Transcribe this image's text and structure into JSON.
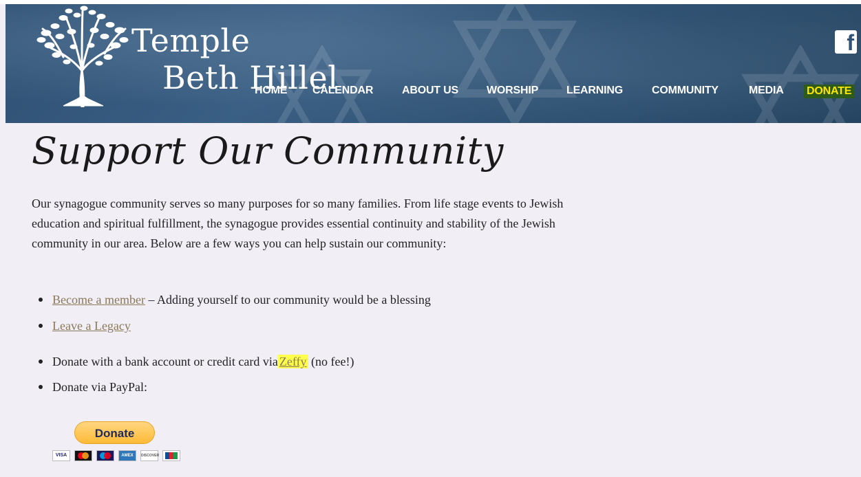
{
  "header": {
    "logo_line1": "Temple",
    "logo_line2": "Beth Hillel",
    "social_icon": "facebook-icon",
    "nav": [
      {
        "label": "HOME"
      },
      {
        "label": "CALENDAR"
      },
      {
        "label": "ABOUT US"
      },
      {
        "label": "WORSHIP"
      },
      {
        "label": "LEARNING"
      },
      {
        "label": "COMMUNITY"
      },
      {
        "label": "MEDIA"
      },
      {
        "label": "DONATE"
      }
    ]
  },
  "main": {
    "title": "Support Our Community",
    "intro": "Our synagogue community serves so many purposes for so many families. From life stage events to Jewish education and spiritual fulfillment, the synagogue provides essential continuity and stability of the Jewish community in our area. Below are a few ways you can help sustain our community:",
    "bullets": [
      {
        "link": "Become a member",
        "text": " – Adding yourself to our community would be a blessing"
      },
      {
        "link": "Leave a Legacy"
      },
      {
        "pre": "Donate with a bank account or credit card via",
        "link": "Zeffy",
        "post": " (no fee!)"
      },
      {
        "text": "Donate via PayPal:"
      }
    ],
    "paypal": {
      "button_label": "Donate",
      "cards": [
        "VISA",
        "MC",
        "Maestro",
        "AMEX",
        "DISCOVER",
        "JCB"
      ]
    }
  },
  "colors": {
    "header_bg": "#2e5274",
    "page_bg": "#f1eef6",
    "link": "#8a7a5a",
    "donate_nav_text": "#ffe600",
    "highlight": "#ffff4d",
    "paypal_button": "#ffc439"
  }
}
